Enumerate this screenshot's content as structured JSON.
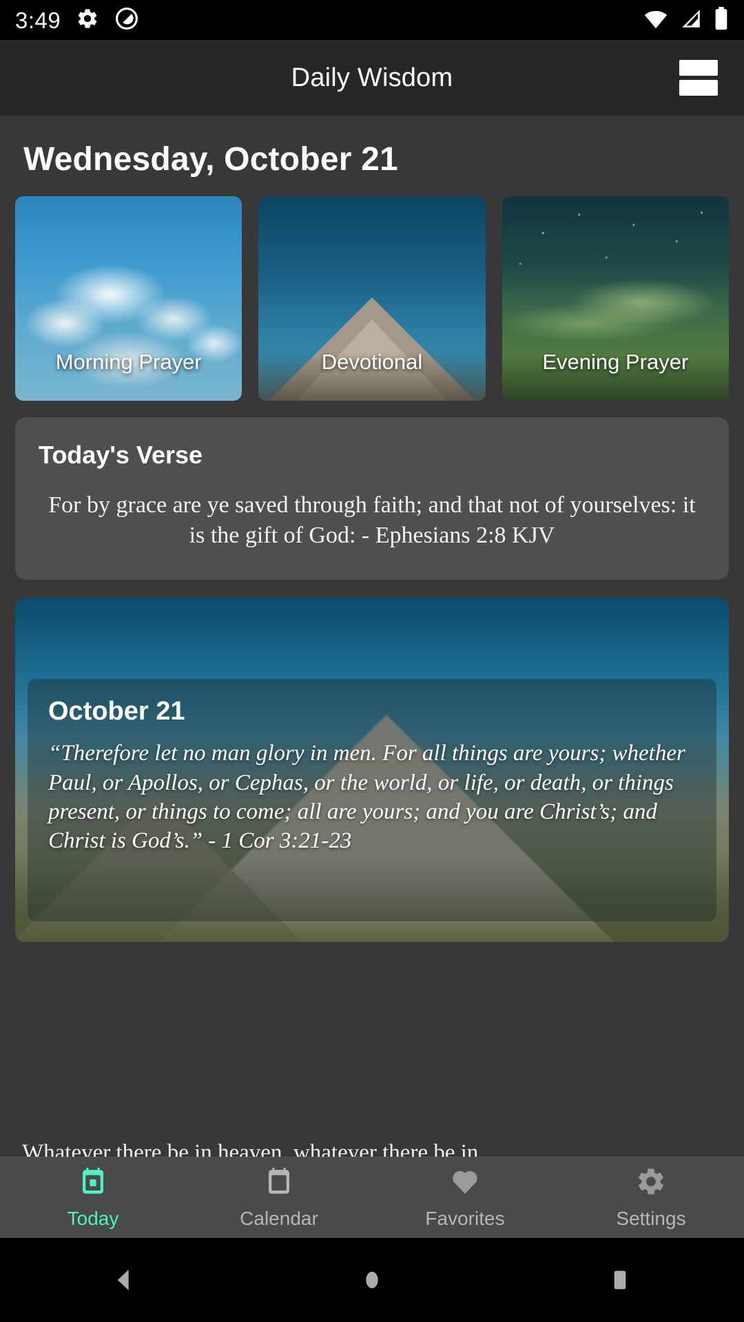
{
  "status_bar": {
    "time": "3:49",
    "left_icons": [
      "gear-icon",
      "dnd-circle-icon"
    ],
    "right_icons": [
      "wifi-icon",
      "cell-signal-icon",
      "battery-icon"
    ]
  },
  "app_bar": {
    "title": "Daily Wisdom",
    "menu_icon": "hamburger-menu-icon"
  },
  "main": {
    "date_heading": "Wednesday, October 21",
    "category_cards": [
      {
        "label": "Morning Prayer",
        "art": "clouds-blue-sky"
      },
      {
        "label": "Devotional",
        "art": "mountain-peak"
      },
      {
        "label": "Evening Prayer",
        "art": "starry-green-hills"
      }
    ],
    "verse_card": {
      "title": "Today's Verse",
      "text": "For by grace are ye saved through faith; and that not of yourselves: it is the gift of God: - Ephesians 2:8 KJV"
    },
    "hero_card": {
      "date": "October 21",
      "quote": "“Therefore let no man glory in men. For all things are yours; whether Paul, or Apollos, or Cephas, or the world, or life, or death, or things present, or things to come; all are yours; and you are Christ’s; and Christ is God’s.” - 1 Cor 3:21-23",
      "body": "Whatever there be in heaven, whatever there be in"
    }
  },
  "bottom_nav": {
    "items": [
      {
        "label": "Today",
        "icon": "calendar-today-icon",
        "active": true
      },
      {
        "label": "Calendar",
        "icon": "calendar-icon",
        "active": false
      },
      {
        "label": "Favorites",
        "icon": "heart-icon",
        "active": false
      },
      {
        "label": "Settings",
        "icon": "gear-icon",
        "active": false
      }
    ],
    "active_color": "#4ef0c7",
    "inactive_color": "#b6b6b6"
  },
  "android_nav": {
    "buttons": [
      "back-icon",
      "home-icon",
      "recents-icon"
    ]
  }
}
